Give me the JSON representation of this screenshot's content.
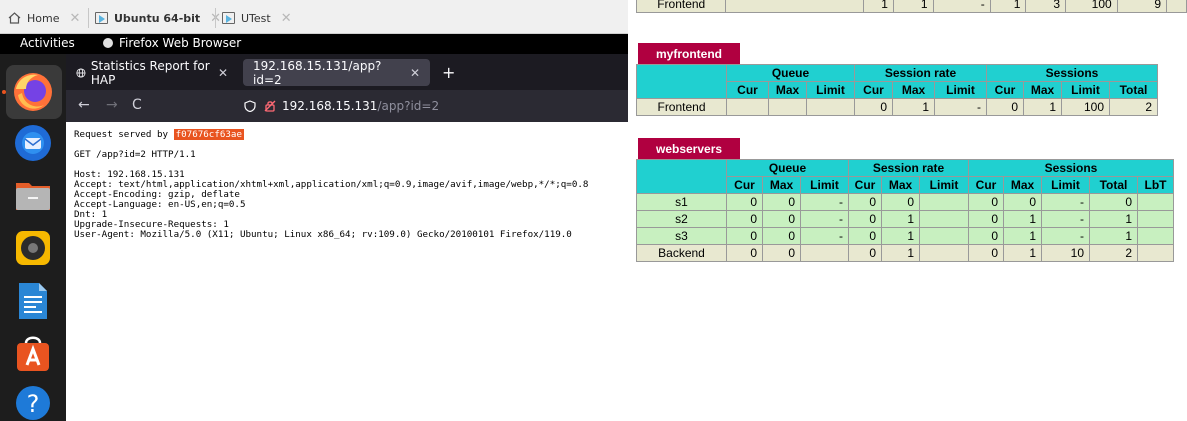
{
  "vm_tabs": [
    {
      "label": "Home",
      "icon": "home-icon"
    },
    {
      "label": "Ubuntu 64-bit",
      "icon": "vm-icon"
    },
    {
      "label": "UTest",
      "icon": "vm-icon"
    }
  ],
  "topbar": {
    "activities": "Activities",
    "app_name": "Firefox Web Browser"
  },
  "dock": [
    {
      "icon": "firefox-icon"
    },
    {
      "icon": "thunderbird-icon"
    },
    {
      "icon": "files-icon"
    },
    {
      "icon": "rhythmbox-icon"
    },
    {
      "icon": "libreoffice-writer-icon"
    },
    {
      "icon": "app-center-icon"
    },
    {
      "icon": "help-icon"
    }
  ],
  "firefox": {
    "tabs": [
      {
        "title": "Statistics Report for HAP",
        "active": true
      },
      {
        "title": "192.168.15.131/app?id=2",
        "active": false
      }
    ],
    "url_host": "192.168.15.131",
    "url_path": "/app?id=2",
    "content": {
      "served_label": "Request served by",
      "server_id": "f07676cf63ae",
      "request_line": "GET /app?id=2 HTTP/1.1",
      "headers": [
        "Host: 192.168.15.131",
        "Accept: text/html,application/xhtml+xml,application/xml;q=0.9,image/avif,image/webp,*/*;q=0.8",
        "Accept-Encoding: gzip, deflate",
        "Accept-Language: en-US,en;q=0.5",
        "Dnt: 1",
        "Upgrade-Insecure-Requests: 1",
        "User-Agent: Mozilla/5.0 (X11; Ubuntu; Linux x86_64; rv:109.0) Gecko/20100101 Firefox/119.0"
      ]
    }
  },
  "stats": {
    "top_row": {
      "name": "Frontend",
      "values": [
        "1",
        "1",
        "-",
        "1",
        "3",
        "100",
        "9"
      ]
    },
    "myfrontend": {
      "title": "myfrontend",
      "groups": [
        "Queue",
        "Session rate",
        "Sessions"
      ],
      "columns": [
        "Cur",
        "Max",
        "Limit",
        "Cur",
        "Max",
        "Limit",
        "Cur",
        "Max",
        "Limit",
        "Total"
      ],
      "rows": [
        {
          "name": "Frontend",
          "cells": [
            "",
            "",
            "",
            "0",
            "1",
            "-",
            "0",
            "1",
            "100",
            "2"
          ]
        }
      ]
    },
    "webservers": {
      "title": "webservers",
      "groups": [
        "Queue",
        "Session rate",
        "Sessions"
      ],
      "columns": [
        "Cur",
        "Max",
        "Limit",
        "Cur",
        "Max",
        "Limit",
        "Cur",
        "Max",
        "Limit",
        "Total",
        "LbT"
      ],
      "rows": [
        {
          "name": "s1",
          "cells": [
            "0",
            "0",
            "-",
            "0",
            "0",
            "",
            "0",
            "0",
            "-",
            "0",
            ""
          ]
        },
        {
          "name": "s2",
          "cells": [
            "0",
            "0",
            "-",
            "0",
            "1",
            "",
            "0",
            "1",
            "-",
            "1",
            ""
          ]
        },
        {
          "name": "s3",
          "cells": [
            "0",
            "0",
            "-",
            "0",
            "1",
            "",
            "0",
            "1",
            "-",
            "1",
            ""
          ]
        },
        {
          "name": "Backend",
          "cells": [
            "0",
            "0",
            "",
            "0",
            "1",
            "",
            "0",
            "1",
            "10",
            "2",
            ""
          ]
        }
      ]
    }
  }
}
